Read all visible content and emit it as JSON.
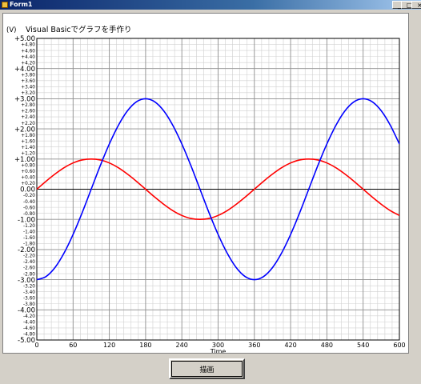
{
  "window": {
    "title": "Form1",
    "buttons": {
      "minimize": "_",
      "maximize": "□",
      "close": "×"
    }
  },
  "button": {
    "draw_label": "描画"
  },
  "chart_data": {
    "type": "line",
    "title": "Visual Basicでグラフを手作り",
    "ylabel": "(V)",
    "xlabel": "Time",
    "xlim": [
      0,
      600
    ],
    "ylim": [
      -5,
      5
    ],
    "x_ticks": [
      0,
      60,
      120,
      180,
      240,
      300,
      360,
      420,
      480,
      540,
      600
    ],
    "y_major_ticks": [
      5,
      4,
      3,
      2,
      1,
      0,
      -1,
      -2,
      -3,
      -4,
      -5
    ],
    "y_minor_step": 0.2,
    "grid": true,
    "series": [
      {
        "color": "#ff0000",
        "x": [
          0,
          15,
          30,
          45,
          60,
          75,
          90,
          105,
          120,
          135,
          150,
          165,
          180,
          195,
          210,
          225,
          240,
          255,
          270,
          285,
          300,
          315,
          330,
          345,
          360,
          375,
          390,
          405,
          420,
          435,
          450,
          465,
          480,
          495,
          510,
          525,
          540,
          555,
          570,
          585,
          600
        ],
        "y": [
          0,
          0.26,
          0.5,
          0.71,
          0.87,
          0.97,
          1.0,
          0.97,
          0.87,
          0.71,
          0.5,
          0.26,
          0,
          -0.26,
          -0.5,
          -0.71,
          -0.87,
          -0.97,
          -1.0,
          -0.97,
          -0.87,
          -0.71,
          -0.5,
          -0.26,
          0,
          0.26,
          0.5,
          0.71,
          0.87,
          0.97,
          1.0,
          0.97,
          0.87,
          0.71,
          0.5,
          0.26,
          0,
          -0.26,
          -0.5,
          -0.71,
          -0.87
        ]
      },
      {
        "color": "#0000ff",
        "x": [
          0,
          15,
          30,
          45,
          60,
          75,
          90,
          105,
          120,
          135,
          150,
          165,
          180,
          195,
          210,
          225,
          240,
          255,
          270,
          285,
          300,
          315,
          330,
          345,
          360,
          375,
          390,
          405,
          420,
          435,
          450,
          465,
          480,
          495,
          510,
          525,
          540,
          555,
          570,
          585,
          600
        ],
        "y": [
          -3.0,
          -2.9,
          -2.6,
          -2.12,
          -1.5,
          -0.78,
          0,
          0.78,
          1.5,
          2.12,
          2.6,
          2.9,
          3.0,
          2.9,
          2.6,
          2.12,
          1.5,
          0.78,
          0,
          -0.78,
          -1.5,
          -2.12,
          -2.6,
          -2.9,
          -3.0,
          -2.9,
          -2.6,
          -2.12,
          -1.5,
          -0.78,
          0,
          0.78,
          1.5,
          2.12,
          2.6,
          2.9,
          3.0,
          2.9,
          2.6,
          2.12,
          1.5
        ]
      }
    ]
  }
}
